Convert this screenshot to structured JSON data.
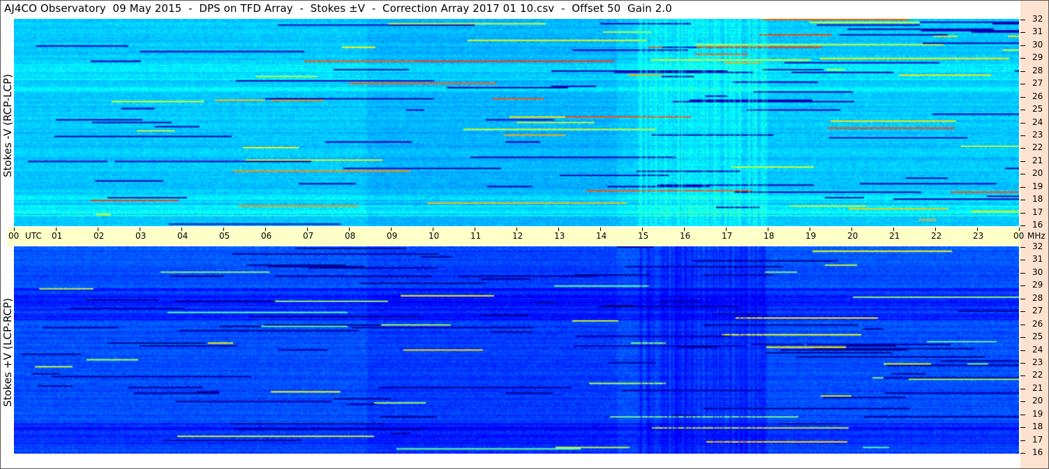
{
  "title": "AJ4CO Observatory  09 May 2015  -  DPS on TFD Array  -  Stokes ±V  -  Correction Array 2017 01 10.csv  -  Offset 50  Gain 2.0",
  "panels": {
    "top_ylabel": "Stokes -V (RCP-LCP)",
    "bottom_ylabel": "Stokes +V (LCP-RCP)"
  },
  "time_axis": {
    "start_label": "00",
    "unit_label": "UTC",
    "end_label": "00",
    "hours": [
      "01",
      "02",
      "03",
      "04",
      "05",
      "06",
      "07",
      "08",
      "09",
      "10",
      "11",
      "12",
      "13",
      "14",
      "15",
      "16",
      "17",
      "18",
      "19",
      "20",
      "21",
      "22",
      "23"
    ]
  },
  "freq_axis": {
    "unit_label": "MHz",
    "ticks": [
      32,
      31,
      30,
      29,
      28,
      27,
      26,
      25,
      24,
      23,
      22,
      21,
      20,
      19,
      18,
      17,
      16
    ]
  },
  "colors": {
    "top_base": "#1a8cf0",
    "bottom_base": "#1446d8",
    "time_strip": "#ffffc8",
    "right_strip": "#fde2cf"
  },
  "chart_data": [
    {
      "type": "heatmap",
      "title": "Stokes -V (RCP-LCP)",
      "xlabel": "UTC",
      "ylabel": "MHz",
      "xlim": [
        0,
        24
      ],
      "ylim": [
        16,
        32
      ],
      "colormap": "jet"
    },
    {
      "type": "heatmap",
      "title": "Stokes +V (LCP-RCP)",
      "xlabel": "UTC",
      "ylabel": "MHz",
      "xlim": [
        0,
        24
      ],
      "ylim": [
        16,
        32
      ],
      "colormap": "jet"
    }
  ]
}
